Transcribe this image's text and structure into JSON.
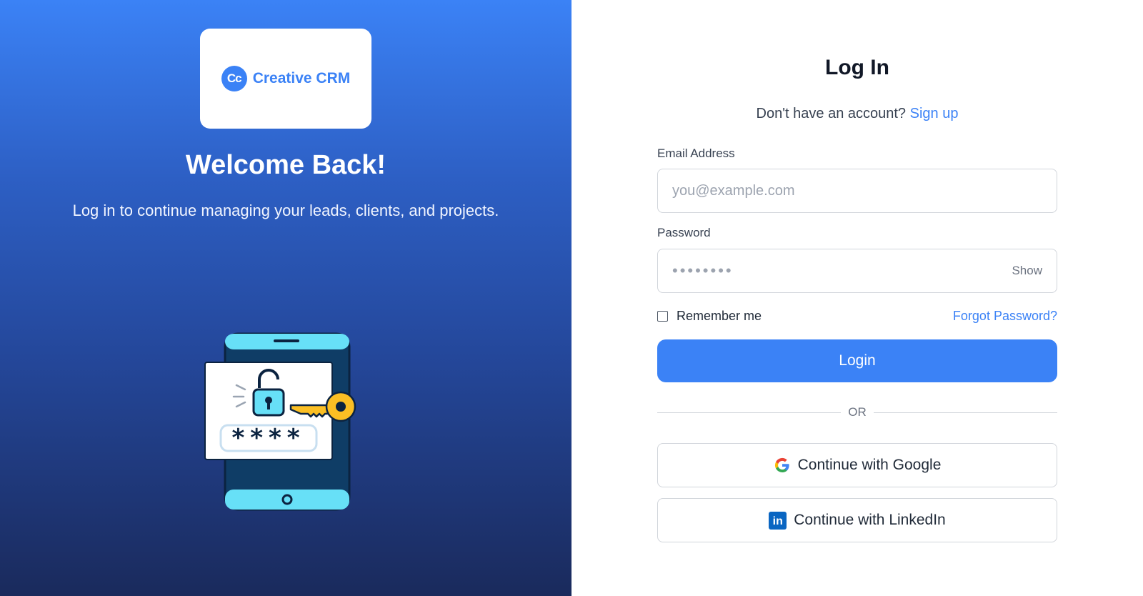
{
  "brand": {
    "logo_mark": "Cc",
    "name": "Creative CRM",
    "color": "#3b82f6"
  },
  "hero": {
    "title": "Welcome Back!",
    "subtitle": "Log in to continue managing your leads, clients, and projects.",
    "illustration_passcode": "****"
  },
  "login": {
    "title": "Log In",
    "no_account_text": "Don't have an account?",
    "signup_link": "Sign up",
    "email": {
      "label": "Email Address",
      "placeholder": "you@example.com",
      "value": ""
    },
    "password": {
      "label": "Password",
      "masked_value": "••••••••",
      "show_label": "Show"
    },
    "remember_label": "Remember me",
    "remember_checked": false,
    "forgot_link": "Forgot Password?",
    "submit_label": "Login",
    "divider_label": "OR",
    "google_label": "Continue with Google",
    "linkedin_label": "Continue with LinkedIn",
    "linkedin_icon_text": "in"
  },
  "colors": {
    "accent": "#3b82f6",
    "panel_gradient_top": "#3b82f6",
    "panel_gradient_bottom": "#1a2a5c",
    "linkedin": "#0a66c2"
  },
  "icons": [
    "creative-crm-logo-icon",
    "phone-lock-illustration",
    "google-icon",
    "linkedin-icon"
  ]
}
